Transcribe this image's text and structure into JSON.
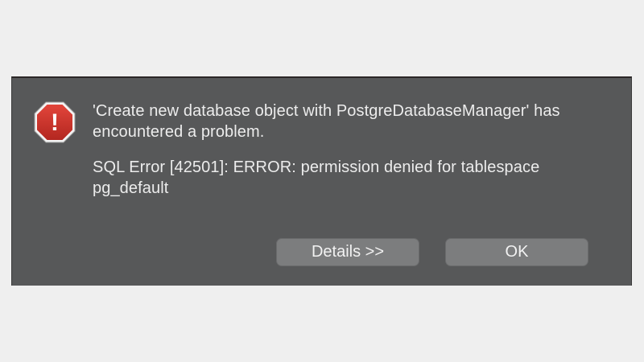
{
  "dialog": {
    "icon": "alert-octagon-icon",
    "icon_glyph": "!",
    "title": "'Create new database object with PostgreDatabaseManager' has encountered a problem.",
    "detail": "SQL Error [42501]: ERROR: permission denied for tablespace pg_default",
    "buttons": {
      "details_label": "Details >>",
      "ok_label": "OK"
    }
  },
  "colors": {
    "background": "#efefef",
    "dialog_background": "#575859",
    "text": "#ececec",
    "button": "#7c7d7e",
    "icon_red": "#c6312a"
  }
}
